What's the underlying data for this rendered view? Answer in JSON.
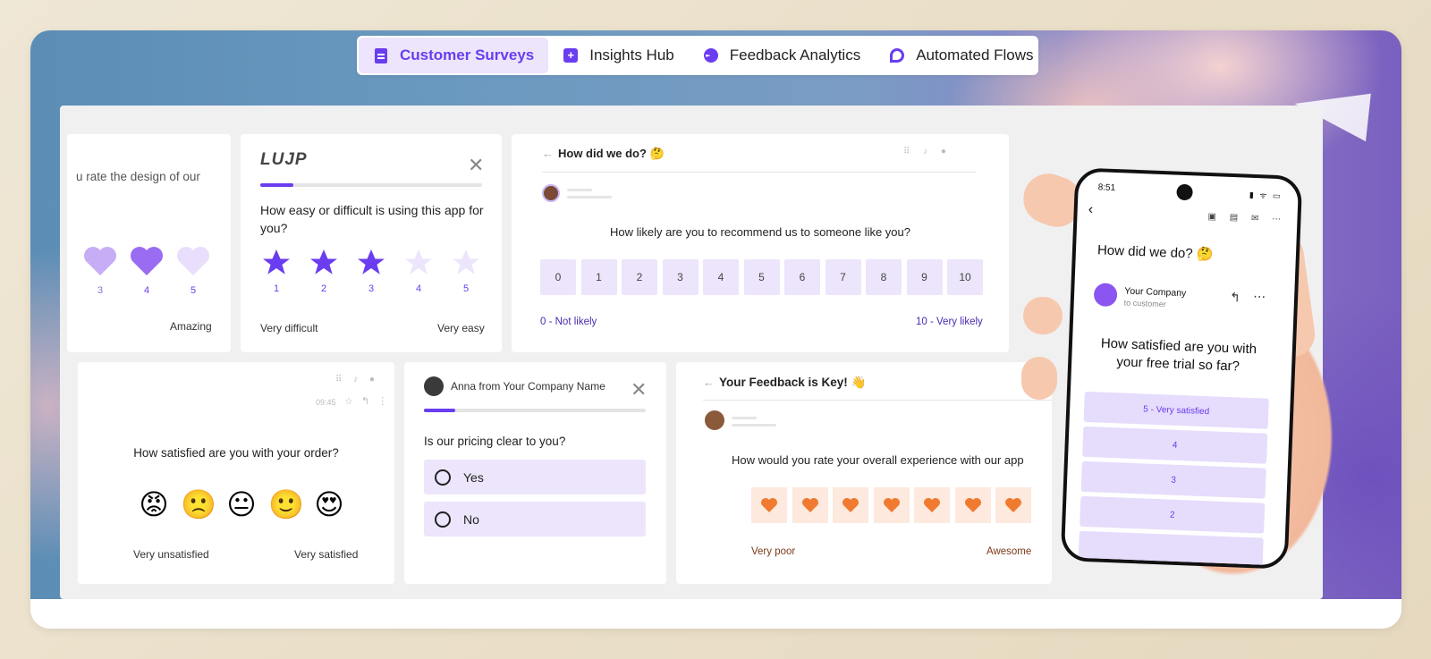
{
  "nav": {
    "tabs": [
      {
        "label": "Customer Surveys",
        "active": true,
        "icon": "clipboard-icon"
      },
      {
        "label": "Insights Hub",
        "active": false,
        "icon": "plus-square-icon"
      },
      {
        "label": "Feedback Analytics",
        "active": false,
        "icon": "pie-chart-icon"
      },
      {
        "label": "Automated Flows",
        "active": false,
        "icon": "flow-icon"
      }
    ]
  },
  "colors": {
    "accent": "#6a3df0",
    "option_bg": "#ece5fb",
    "orange": "#f07b30"
  },
  "card_hearts": {
    "question": "u rate the design of our",
    "hearts": [
      "3",
      "4",
      "5"
    ],
    "right_label": "Amazing"
  },
  "card_stars": {
    "logo": "LUJP",
    "progress": 0.15,
    "question": "How easy or difficult is using this app for you?",
    "stars": [
      "1",
      "2",
      "3",
      "4",
      "5"
    ],
    "filled": 3,
    "left_label": "Very difficult",
    "right_label": "Very easy"
  },
  "card_nps": {
    "title": "How did we do? 🤔",
    "question": "How likely are you to recommend us to someone like you?",
    "scale": [
      "0",
      "1",
      "2",
      "3",
      "4",
      "5",
      "6",
      "7",
      "8",
      "9",
      "10"
    ],
    "left_label": "0 - Not likely",
    "right_label": "10 - Very likely"
  },
  "card_emoji": {
    "time": "09:45",
    "question": "How satisfied are you with your order?",
    "emojis": [
      "😡",
      "🙁",
      "😐",
      "🙂",
      "😍"
    ],
    "left_label": "Very unsatisfied",
    "right_label": "Very satisfied"
  },
  "card_pricing": {
    "sender": "Anna from Your Company Name",
    "progress": 0.14,
    "question": "Is our pricing clear to you?",
    "options": [
      "Yes",
      "No"
    ]
  },
  "card_feedback": {
    "title": "Your Feedback is Key! 👋",
    "question": "How would you rate your overall experience with our app",
    "left_label": "Very poor",
    "right_label": "Awesome",
    "count": 7
  },
  "phone": {
    "time": "8:51",
    "subject": "How did we do? 🤔",
    "sender": "Your Company",
    "recipient": "to customer",
    "question": "How satisfied are you with your free trial so far?",
    "options": [
      "5 - Very satisfied",
      "4",
      "3",
      "2"
    ]
  }
}
